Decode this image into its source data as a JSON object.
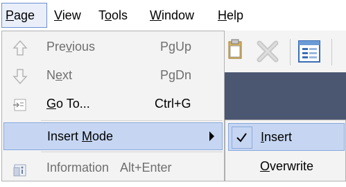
{
  "menubar": {
    "page": "Page",
    "view": "View",
    "tools": "Tools",
    "window": "Window",
    "help": "Help"
  },
  "page_menu": {
    "previous": {
      "label_pre": "Pre",
      "label_u": "v",
      "label_post": "ious",
      "shortcut": "PgUp",
      "icon": "arrow-up-icon",
      "enabled": false
    },
    "next": {
      "label_pre": "N",
      "label_u": "e",
      "label_post": "xt",
      "shortcut": "PgDn",
      "icon": "arrow-down-icon",
      "enabled": false
    },
    "goto": {
      "label_pre": "",
      "label_u": "G",
      "label_post": "o To...",
      "shortcut": "Ctrl+G",
      "icon": "goto-page-icon",
      "enabled": true
    },
    "insert_mode": {
      "label_pre": "Insert ",
      "label_u": "M",
      "label_post": "ode",
      "highlighted": true
    },
    "information": {
      "label": "Information",
      "shortcut": "Alt+Enter",
      "icon": "information-icon",
      "enabled": false
    }
  },
  "insert_submenu": {
    "insert": {
      "label_pre": "",
      "label_u": "I",
      "label_post": "nsert",
      "checked": true
    },
    "overwrite": {
      "label_pre": "",
      "label_u": "O",
      "label_post": "verwrite",
      "checked": false
    }
  },
  "colors": {
    "menu_bg": "#f3f3f3",
    "highlight_bg": "#c6d6f2",
    "highlight_border": "#8aa9dd",
    "disabled_text": "#6f6f6f",
    "app_dark": "#4b5671"
  }
}
